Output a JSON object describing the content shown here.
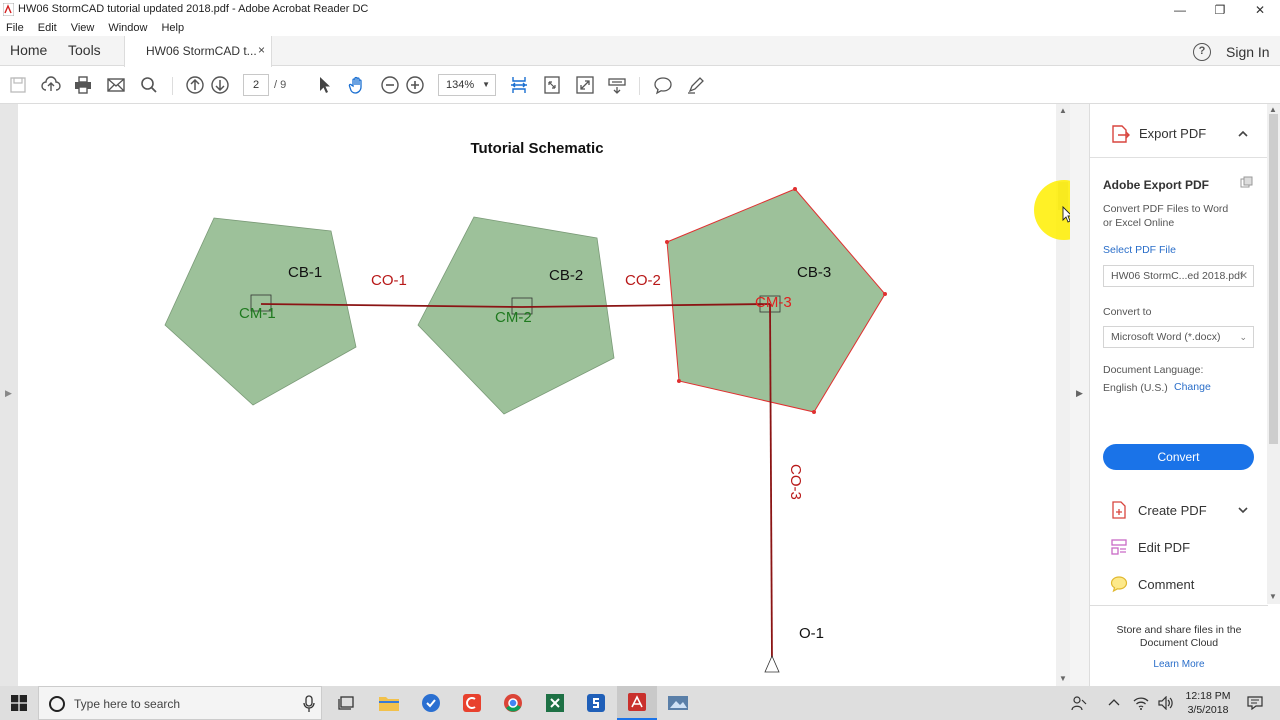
{
  "window": {
    "title": "HW06 StormCAD tutorial updated 2018.pdf - Adobe Acrobat Reader DC",
    "minimize": "—",
    "maximize": "❐",
    "close": "✕"
  },
  "menu": [
    "File",
    "Edit",
    "View",
    "Window",
    "Help"
  ],
  "tabs": {
    "home": "Home",
    "tools": "Tools",
    "document": "HW06 StormCAD t...",
    "close": "×",
    "help": "?",
    "sign_in": "Sign In"
  },
  "toolbar": {
    "page_current": "2",
    "page_total": "/ 9",
    "zoom": "134%",
    "zoom_caret": "▼"
  },
  "document": {
    "title": "Tutorial Schematic",
    "labels": {
      "cb1": "CB-1",
      "cb2": "CB-2",
      "cb3": "CB-3",
      "cm1": "CM-1",
      "cm2": "CM-2",
      "cm3": "CM-3",
      "co1": "CO-1",
      "co2": "CO-2",
      "co3": "CO-3",
      "o1": "O-1"
    },
    "colors": {
      "catchment_fill": "#9dc19a",
      "pipe": "#8b1414",
      "selected_outline": "#e03030",
      "cm_label_green": "#1f7a1f",
      "cm_label_red": "#e02020",
      "co_label": "#b81818",
      "cursor_highlight": "#ffee00"
    }
  },
  "panel": {
    "export_header": "Export PDF",
    "adobe_export": "Adobe Export PDF",
    "desc_line1": "Convert PDF Files to Word",
    "desc_line2": "or Excel Online",
    "select_file": "Select PDF File",
    "file_name": "HW06 StormC...ed 2018.pdf",
    "file_clear": "✕",
    "convert_to": "Convert to",
    "format": "Microsoft Word (*.docx)",
    "format_caret": "⌄",
    "doc_lang": "Document Language:",
    "lang": "English (U.S.)",
    "change": "Change",
    "convert_btn": "Convert",
    "create_pdf": "Create PDF",
    "edit_pdf": "Edit PDF",
    "comment": "Comment",
    "cloud_text": "Store and share files in the Document Cloud",
    "learn_more": "Learn More"
  },
  "taskbar": {
    "search_placeholder": "Type here to search",
    "time": "12:18 PM",
    "date": "3/5/2018"
  }
}
